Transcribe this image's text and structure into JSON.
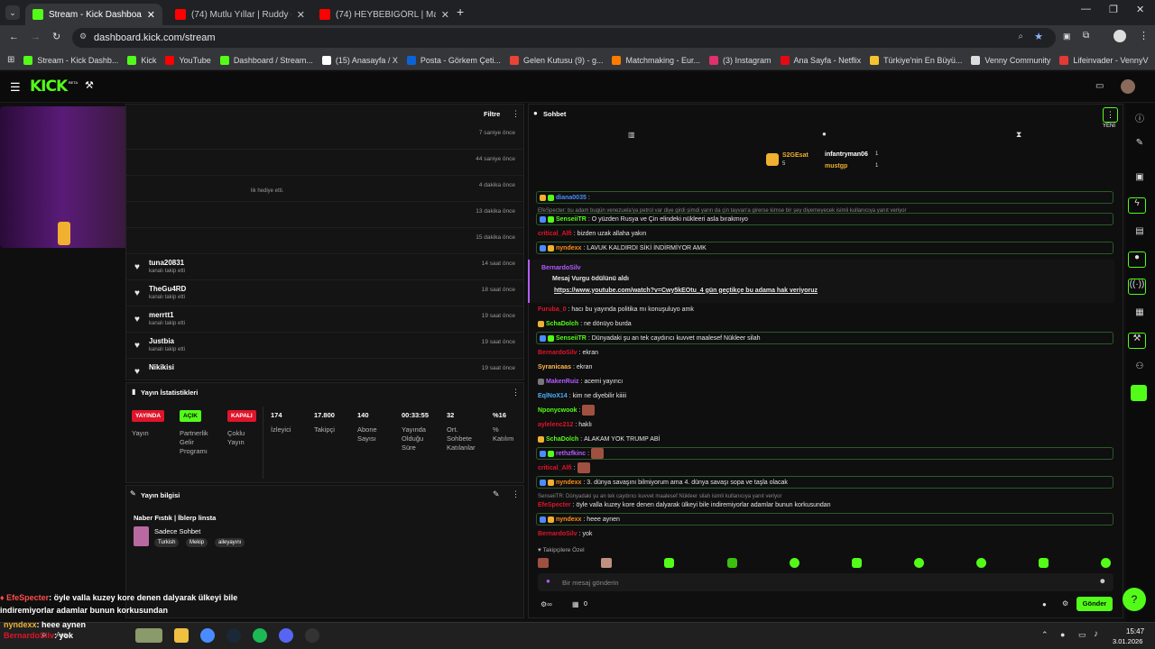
{
  "browser": {
    "tabs": [
      {
        "label": "Stream - Kick Dashboard",
        "color": "#53fc18"
      },
      {
        "label": "(74) Mutlu Yıllar | Ruddy - YouT",
        "color": "#ff0000"
      },
      {
        "label": "(74) HEYBEBİGÖRL | Madara Oł",
        "color": "#ff0000"
      }
    ],
    "url": "dashboard.kick.com/stream",
    "bookmarks": [
      {
        "label": "Stream - Kick Dashb...",
        "color": "#53fc18"
      },
      {
        "label": "Kick",
        "color": "#53fc18"
      },
      {
        "label": "YouTube",
        "color": "#ff0000"
      },
      {
        "label": "Dashboard / Stream...",
        "color": "#53fc18"
      },
      {
        "label": "(15) Anasayfa / X",
        "color": "#ffffff"
      },
      {
        "label": "Posta - Görkem Çeti...",
        "color": "#0a64d8"
      },
      {
        "label": "Gelen Kutusu (9) - g...",
        "color": "#ea4335"
      },
      {
        "label": "Matchmaking - Eur...",
        "color": "#ff7a00"
      },
      {
        "label": "(3) Instagram",
        "color": "#e1306c"
      },
      {
        "label": "Ana Sayfa - Netflix",
        "color": "#e50914"
      },
      {
        "label": "Türkiye'nin En Büyü...",
        "color": "#f4c430"
      },
      {
        "label": "Venny Community",
        "color": "#dddddd"
      },
      {
        "label": "Lifeinvader - VennyV",
        "color": "#e53935"
      }
    ]
  },
  "kick": {
    "logo": "KICK",
    "beta": "BETA"
  },
  "activity": {
    "filter_label": "Filtre",
    "rows": [
      {
        "name": "",
        "sub": "",
        "time": "7 saniye önce"
      },
      {
        "name": "",
        "sub": "",
        "time": "44 saniye önce"
      },
      {
        "name": "",
        "sub": "lik hediye etti.",
        "time": "4 dakika önce"
      },
      {
        "name": "",
        "sub": "",
        "time": "13 dakika önce"
      },
      {
        "name": "",
        "sub": "",
        "time": "15 dakika önce"
      },
      {
        "name": "tuna20831",
        "sub": "kanalı takip etti",
        "time": "14 saat önce"
      },
      {
        "name": "TheGu4RD",
        "sub": "kanalı takip etti",
        "time": "18 saat önce"
      },
      {
        "name": "merrtt1",
        "sub": "kanalı takip etti",
        "time": "19 saat önce"
      },
      {
        "name": "Justbia",
        "sub": "kanalı takip etti",
        "time": "19 saat önce"
      },
      {
        "name": "Nikikisi",
        "sub": "kanalı takip etti",
        "time": "19 saat önce"
      }
    ]
  },
  "stats": {
    "title": "Yayın İstatistikleri",
    "items": [
      {
        "badge": "YAYINDA",
        "badge_color": "#e0142a",
        "label": "Yayın"
      },
      {
        "badge": "AÇIK",
        "badge_color": "#53fc18",
        "label": "Partnerlik Gelir Programı"
      },
      {
        "badge": "KAPALI",
        "badge_color": "#e0142a",
        "label": "Çoklu Yayın"
      },
      {
        "value": "174",
        "label": "İzleyici"
      },
      {
        "value": "17.800",
        "label": "Takipçi"
      },
      {
        "value": "140",
        "label": "Abone Sayısı"
      },
      {
        "value": "00:33:55",
        "label": "Yayında Olduğu Süre"
      },
      {
        "value": "32",
        "label": "Ort. Sohbete Katılanlar"
      },
      {
        "value": "%16",
        "label": "% Katılım"
      }
    ]
  },
  "stream_info": {
    "title": "Yayın bilgisi",
    "stream_title": "Naber Fıstık | İblerp linsta",
    "category": "Sadece Sohbet",
    "tags": [
      "Turkish",
      "Mekip",
      "aileyayını"
    ]
  },
  "chat": {
    "title": "Sohbet",
    "new_label": "YENİ",
    "top_gifters": [
      {
        "name": "S2GEsat",
        "count": "5"
      },
      {
        "name": "infantryman06",
        "count": "1"
      },
      {
        "name": "mustgp",
        "count": "1"
      }
    ],
    "messages": [
      {
        "user": "diana0035",
        "color": "#4a8cff",
        "text": "",
        "hl": true
      },
      {
        "user": "",
        "color": "#888888",
        "text": "EfeSpecter: bu adam bugün venezuela'ya petrol var diye girdi şimdi yarın da çin tayvan'a girerse kimse bir şey diyemeyecek isimli kullanıcıya yanıt veriyor",
        "hl": false,
        "reply": true
      },
      {
        "user": "SenseiiTR",
        "color": "#53fc18",
        "text": "O yüzden Rusya ve Çin elindeki nükleeri asla bırakmıyo",
        "hl": true
      },
      {
        "user": "critical_Alfi",
        "color": "#e0142a",
        "text": "bizden uzak allaha yakın",
        "hl": false
      },
      {
        "user": "nyndexx",
        "color": "#ff8c1a",
        "text": "LAVUK KALDIRDI SİKİ İNDİRMİYOR AMK",
        "hl": true
      },
      {
        "user": "BernardoSilv",
        "color": "#b45cff",
        "text": "Mesaj Vurgu ödülünü aldı",
        "hl": false
      },
      {
        "user": "",
        "color": "#ffffff",
        "text": "https://www.youtube.com/watch?v=Cwy5kEOtu_4 gün geçtikçe bu adama hak veriyoruz",
        "hl": false
      },
      {
        "user": "Furuba_0",
        "color": "#e0142a",
        "text": "hacı bu yayında politika mı konuşuluyo amk",
        "hl": false
      },
      {
        "user": "SchaDolch",
        "color": "#53fc18",
        "text": "ne dönüyo burda",
        "hl": false
      },
      {
        "user": "SenseiiTR",
        "color": "#53fc18",
        "text": "Dünyadaki şu an tek caydırıcı kuvvet maalesef Nükleer silah",
        "hl": true
      },
      {
        "user": "BernardoSilv",
        "color": "#e0142a",
        "text": "ekran",
        "hl": false
      },
      {
        "user": "Syranicaas",
        "color": "#ffb84d",
        "text": "ekran",
        "hl": false
      },
      {
        "user": "MakenRuiz",
        "color": "#b45cff",
        "text": "acemi yayıncı",
        "hl": false
      },
      {
        "user": "EqlNoX14",
        "color": "#4ab0ff",
        "text": "kim ne diyebilir kiiiii",
        "hl": false
      },
      {
        "user": "Nponycwook",
        "color": "#53fc18",
        "text": "",
        "hl": false
      },
      {
        "user": "aylelenc212",
        "color": "#e0142a",
        "text": "haklı",
        "hl": false
      },
      {
        "user": "SchaDolch",
        "color": "#53fc18",
        "text": "ALAKAM YOK TRUMP ABİ",
        "hl": false
      },
      {
        "user": "rethzfkinc",
        "color": "#b45cff",
        "text": "",
        "hl": true
      },
      {
        "user": "critical_Alfi",
        "color": "#e0142a",
        "text": "",
        "hl": false
      },
      {
        "user": "nyndexx",
        "color": "#ff8c1a",
        "text": "3. dünya savaşını bilmiyorum ama 4. dünya savaşı sopa ve taşla olacak",
        "hl": true
      },
      {
        "user": "",
        "color": "#888888",
        "text": "SenseiiTR: Dünyadaki şu an tek caydırıcı kuvvet maalesef Nükleer silah isimli kullanıcıya yanıt veriyor",
        "hl": false,
        "reply": true
      },
      {
        "user": "EfeSpecter",
        "color": "#e0142a",
        "text": "öyle valla kuzey kore denen dalyarak ülkeyi bile indiremiyorlar adamlar bunun korkusundan",
        "hl": false
      },
      {
        "user": "nyndexx",
        "color": "#ff8c1a",
        "text": "heee aynen",
        "hl": true
      },
      {
        "user": "BernardoSilv",
        "color": "#e0142a",
        "text": "yok",
        "hl": false
      }
    ],
    "followers_only_label": "Takipçilere Özel",
    "input_placeholder": "Bir mesaj gönderin",
    "send_label": "Gönder",
    "viewer_count": "0"
  },
  "overlay": {
    "line1_user": "EfeSpecter",
    "line1_text": ": öyle valla kuzey kore denen dalyarak ülkeyi bile",
    "line2_text": "indiremiyorlar adamlar bunun korkusundan",
    "line3_user": "nyndexx",
    "line3_text": ": heee aynen",
    "line4_user": "BernardoSilv",
    "line4_text": ": yok"
  },
  "taskbar": {
    "search": "Ara",
    "time": "15:47",
    "date": "3.01.2026"
  }
}
